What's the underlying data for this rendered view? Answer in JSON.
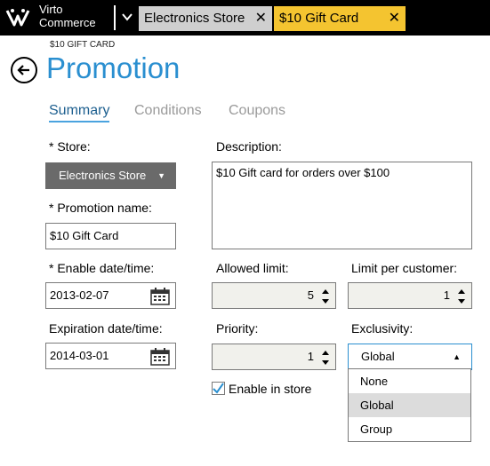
{
  "app": {
    "brand_line1": "Virto",
    "brand_line2": "Commerce"
  },
  "tabs": [
    {
      "label": "Electronics Store"
    },
    {
      "label": "$10 Gift Card"
    }
  ],
  "header": {
    "breadcrumb": "$10 GIFT CARD",
    "title": "Promotion"
  },
  "nav": {
    "summary": "Summary",
    "conditions": "Conditions",
    "coupons": "Coupons"
  },
  "form": {
    "store_label": "* Store:",
    "store_value": "Electronics Store",
    "promo_name_label": "* Promotion name:",
    "promo_name_value": "$10 Gift Card",
    "enable_label": "* Enable date/time:",
    "enable_value": "2013-02-07",
    "expiration_label": "Expiration date/time:",
    "expiration_value": "2014-03-01",
    "description_label": "Description:",
    "description_value": "$10 Gift card for orders over $100",
    "allowed_limit_label": "Allowed limit:",
    "allowed_limit_value": "5",
    "limit_per_customer_label": "Limit per customer:",
    "limit_per_customer_value": "1",
    "priority_label": "Priority:",
    "priority_value": "1",
    "exclusivity_label": "Exclusivity:",
    "exclusivity_value": "Global",
    "exclusivity_options": [
      "None",
      "Global",
      "Group"
    ],
    "enable_in_store_label": "Enable in store",
    "enable_in_store_checked": true
  },
  "colors": {
    "accent": "#2a8fd0",
    "tab_active": "#f4c430",
    "tab_inactive": "#cfcfcf",
    "store_dropdown": "#6a6a6a"
  },
  "icons": {
    "logo": "virto-logo-icon",
    "back": "back-arrow-icon",
    "calendar": "calendar-icon",
    "close": "close-icon"
  }
}
